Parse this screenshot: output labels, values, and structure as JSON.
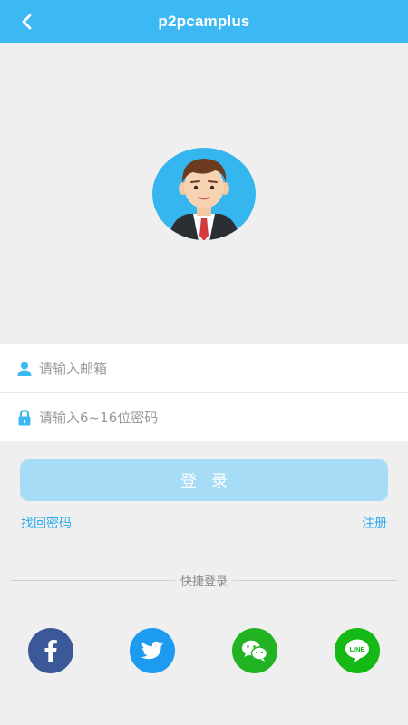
{
  "header": {
    "title": "p2pcamplus"
  },
  "form": {
    "email_placeholder": "请输入邮箱",
    "password_placeholder": "请输入6~16位密码"
  },
  "login_label": "登录",
  "links": {
    "forgot": "找回密码",
    "register": "注册"
  },
  "quick_login_label": "快捷登录",
  "social": [
    {
      "name": "facebook",
      "color": "#3b5998"
    },
    {
      "name": "twitter",
      "color": "#1d9bf0"
    },
    {
      "name": "wechat",
      "color": "#22b323"
    },
    {
      "name": "line",
      "color": "#15b915"
    }
  ],
  "colors": {
    "accent": "#3cb8f2",
    "button_disabled": "#a6dcf6"
  }
}
